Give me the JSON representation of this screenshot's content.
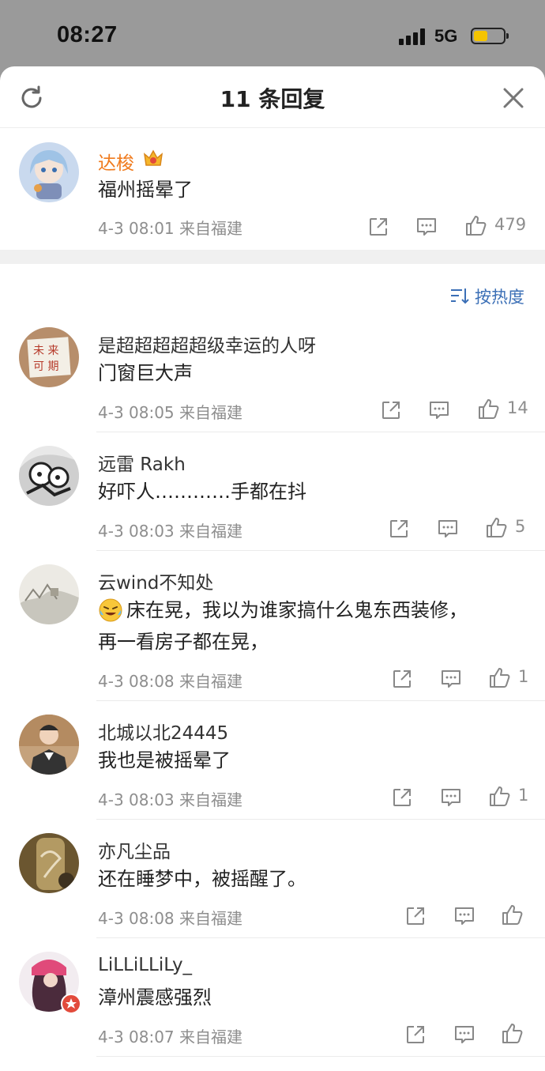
{
  "status": {
    "time": "08:27",
    "network": "5G"
  },
  "header": {
    "title": "11 条回复"
  },
  "root": {
    "name": "达梭",
    "text": "福州摇晕了",
    "time": "4-3 08:01",
    "location": "来自福建",
    "likes": "479"
  },
  "sort": {
    "label": "按热度"
  },
  "replies": [
    {
      "name": "是超超超超超级幸运的人呀",
      "text": "门窗巨大声",
      "time": "4-3 08:05",
      "location": "来自福建",
      "likes": "14"
    },
    {
      "name": "远雷 Rakh",
      "text": "好吓人…………手都在抖",
      "time": "4-3 08:03",
      "location": "来自福建",
      "likes": "5"
    },
    {
      "name": "云wind不知处",
      "text": "床在晃，我以为谁家搞什么鬼东西装修，",
      "text2": "再一看房子都在晃，",
      "time": "4-3 08:08",
      "location": "来自福建",
      "likes": "1"
    },
    {
      "name": "北城以北24445",
      "text": "我也是被摇晕了",
      "time": "4-3 08:03",
      "location": "来自福建",
      "likes": "1"
    },
    {
      "name": "亦凡尘品",
      "text": "还在睡梦中，被摇醒了。",
      "time": "4-3 08:08",
      "location": "来自福建",
      "likes": ""
    },
    {
      "name": "LiLLiLLiLy_",
      "text": "漳州震感强烈",
      "time": "4-3 08:07",
      "location": "来自福建",
      "likes": ""
    }
  ],
  "colors": {
    "op_name": "#f07b1e",
    "link": "#3b6fb6",
    "meta": "#8e8e8e"
  }
}
